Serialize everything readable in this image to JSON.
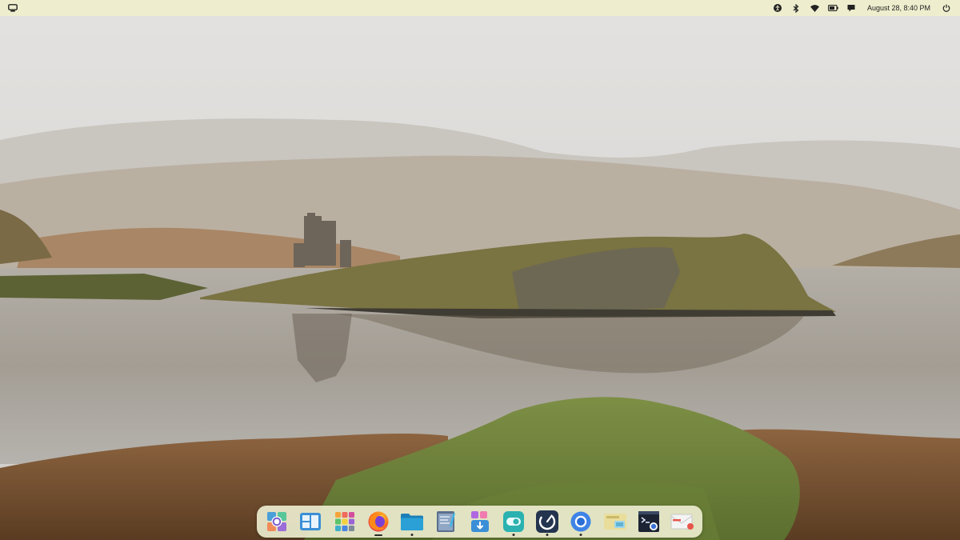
{
  "top_panel": {
    "clock": "August 28, 8:40 PM",
    "colors": {
      "panel_bg": "#eeeecf",
      "text": "#1f1f1f"
    },
    "left_icons": [
      "workspaces-icon"
    ],
    "tray_icons": [
      "accessibility-icon",
      "bluetooth-icon",
      "wifi-icon",
      "battery-icon",
      "notifications-icon",
      "power-icon"
    ]
  },
  "dock": {
    "apps": [
      {
        "icon": "launcher-icon",
        "running": "none"
      },
      {
        "icon": "workspaces-overview-icon",
        "running": "none"
      },
      {
        "icon": "app-grid-icon",
        "running": "none"
      },
      {
        "icon": "firefox-icon",
        "running": "active"
      },
      {
        "icon": "files-icon",
        "running": "dot"
      },
      {
        "icon": "text-editor-icon",
        "running": "none"
      },
      {
        "icon": "software-store-icon",
        "running": "none"
      },
      {
        "icon": "settings-toggle-icon",
        "running": "dot"
      },
      {
        "icon": "system-monitor-icon",
        "running": "dot"
      },
      {
        "icon": "chromium-icon",
        "running": "dot"
      },
      {
        "icon": "screenshot-tool-icon",
        "running": "none"
      },
      {
        "icon": "terminal-icon",
        "running": "none"
      },
      {
        "icon": "mail-client-icon",
        "running": "none"
      }
    ]
  },
  "wallpaper": {
    "subject": "loch-with-castle-ruin-icon",
    "colors": {
      "sky": "#d3d2cf",
      "water": "#a7a39c",
      "grass": "#6e8f3e",
      "heather": "#8a5a35"
    }
  }
}
